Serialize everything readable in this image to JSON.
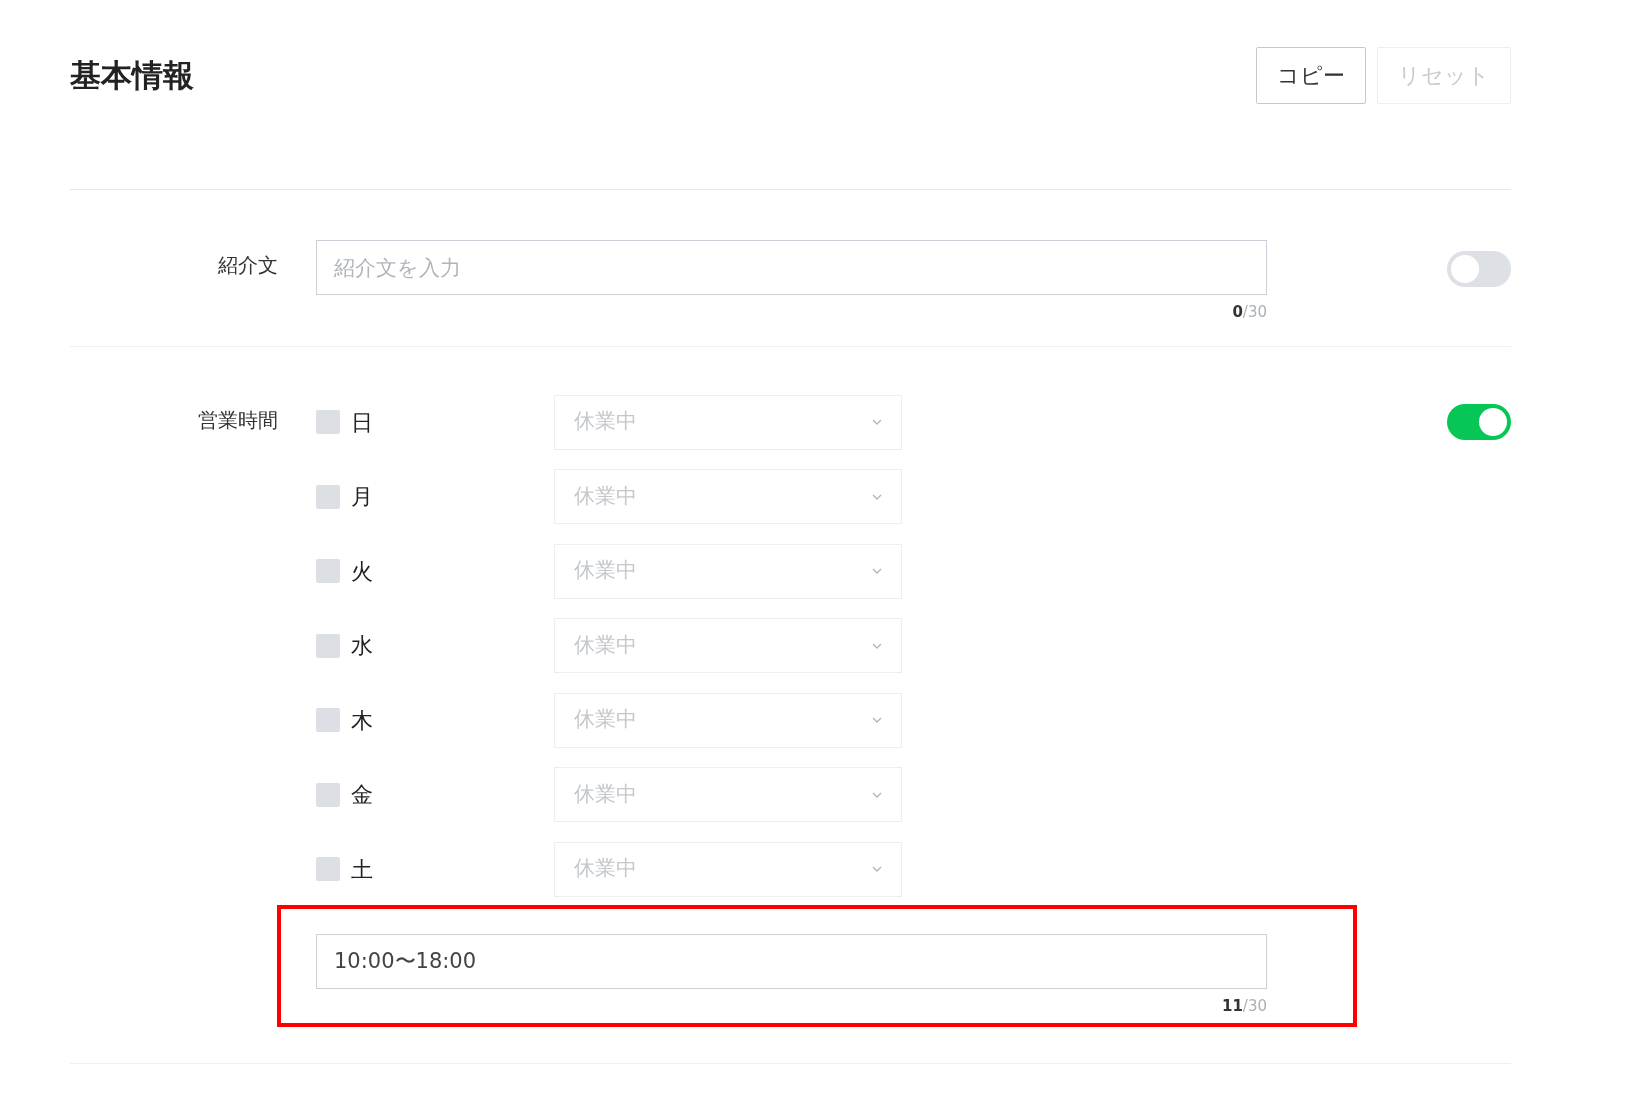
{
  "header": {
    "title": "基本情報",
    "buttons": [
      {
        "label": "コピー",
        "disabled": false
      },
      {
        "label": "リセット",
        "disabled": true
      }
    ]
  },
  "intro": {
    "label": "紹介文",
    "placeholder": "紹介文を入力",
    "count": "0",
    "max": "/30",
    "on": false
  },
  "hours": {
    "label": "営業時間",
    "on": true,
    "days": [
      {
        "label": "日",
        "checked": false,
        "value": "休業中"
      },
      {
        "label": "月",
        "checked": false,
        "value": "休業中"
      },
      {
        "label": "火",
        "checked": false,
        "value": "休業中"
      },
      {
        "label": "水",
        "checked": false,
        "value": "休業中"
      },
      {
        "label": "木",
        "checked": false,
        "value": "休業中"
      },
      {
        "label": "金",
        "checked": false,
        "value": "休業中"
      },
      {
        "label": "土",
        "checked": false,
        "value": "休業中"
      }
    ],
    "note": {
      "value": "10:00〜18:00",
      "count": "11",
      "max": "/30",
      "highlighted": true
    }
  }
}
